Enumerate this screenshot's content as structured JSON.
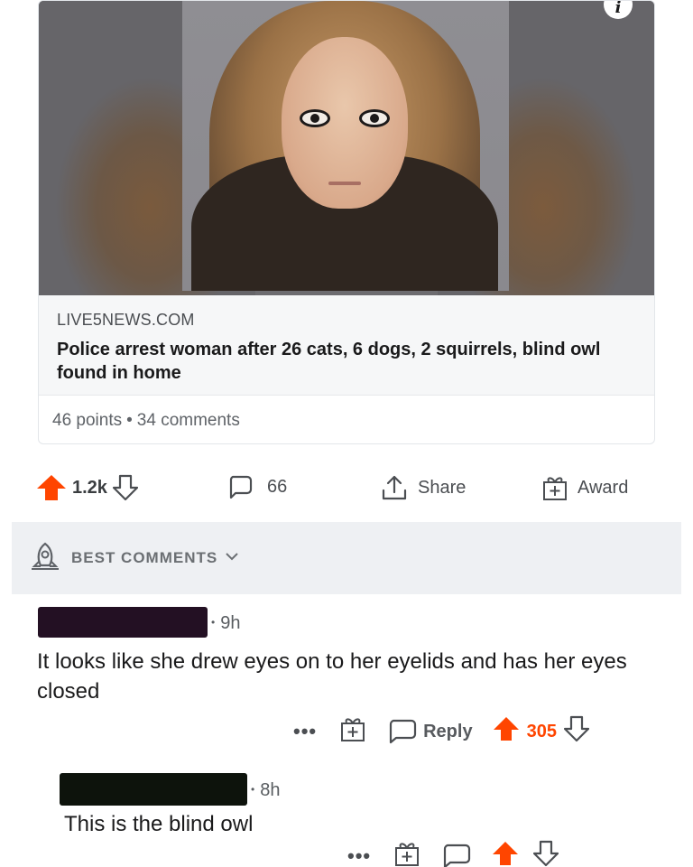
{
  "post": {
    "domain": "LIVE5NEWS.COM",
    "headline": "Police arrest woman after 26 cats, 6 dogs, 2 squirrels, blind owl found in home",
    "points": "46 points",
    "comments_count": "34 comments",
    "info_icon_glyph": "i"
  },
  "actions": {
    "upvotes": "1.2k",
    "comments": "66",
    "share_label": "Share",
    "award_label": "Award"
  },
  "sort": {
    "label": "BEST COMMENTS"
  },
  "comments": [
    {
      "time": "9h",
      "body": "It looks like she drew eyes on to her eyelids and has her eyes closed",
      "more": "•••",
      "reply_label": "Reply",
      "score": "305"
    },
    {
      "time": "8h",
      "body": "This is the blind owl",
      "more": "•••"
    }
  ],
  "colors": {
    "upvote": "#ff4500",
    "text": "#1a1a1b",
    "meta": "#5f6368",
    "sort_bg": "#eef0f3"
  },
  "icons": [
    "info-icon",
    "upvote-arrow-icon",
    "downvote-arrow-icon",
    "comment-bubble-icon",
    "share-icon",
    "gift-icon",
    "rocket-icon",
    "chevron-down-icon",
    "more-icon"
  ]
}
